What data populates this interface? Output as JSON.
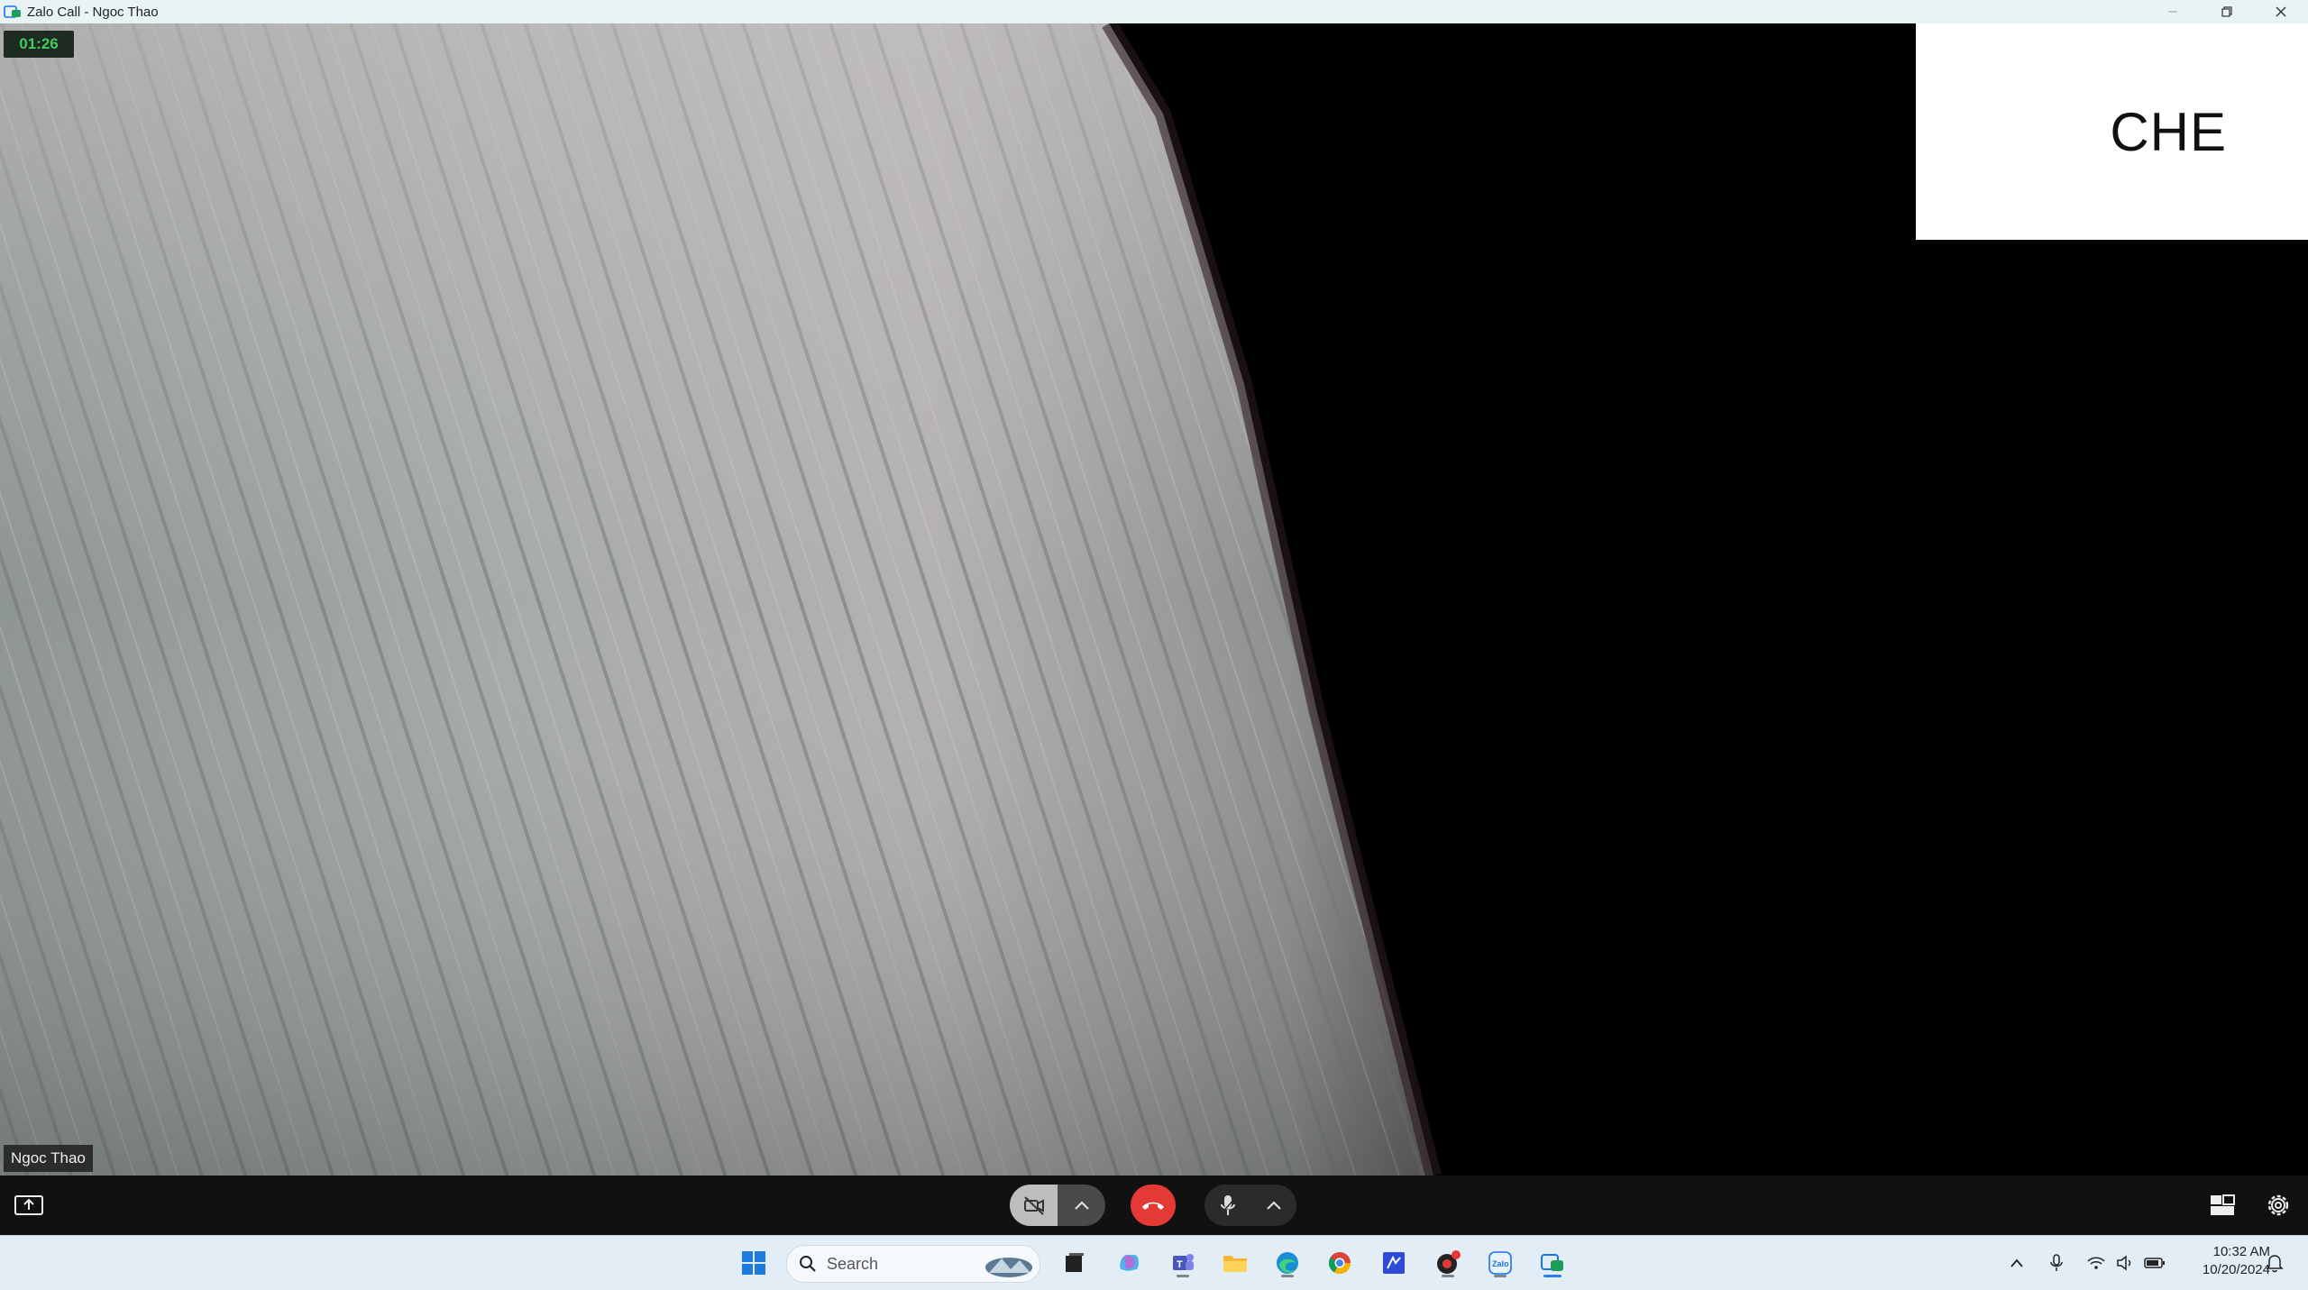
{
  "window": {
    "title": "Zalo Call - Ngoc Thao"
  },
  "call": {
    "timer": "01:26",
    "caller_name": "Ngoc Thao",
    "self_view_text": "CHE"
  },
  "colors": {
    "end_call": "#e53935",
    "timer_text": "#3ecf5a",
    "taskbar": "#e3edf5"
  },
  "controls": {
    "share_screen_icon": "screen-share-icon",
    "camera_icon": "camera-off-icon",
    "end_call_icon": "phone-hangup-icon",
    "mic_icon": "microphone-icon",
    "layout_icon": "layout-grid-icon",
    "settings_icon": "gear-icon"
  },
  "taskbar": {
    "search_placeholder": "Search",
    "apps": [
      "start",
      "search",
      "widgets",
      "task-view",
      "copilot",
      "teams",
      "file-explorer",
      "edge",
      "chrome",
      "visual-studio",
      "screen-recorder",
      "zalo",
      "zalo-call"
    ],
    "clock_time": "10:32 AM",
    "clock_date": "10/20/2024"
  }
}
